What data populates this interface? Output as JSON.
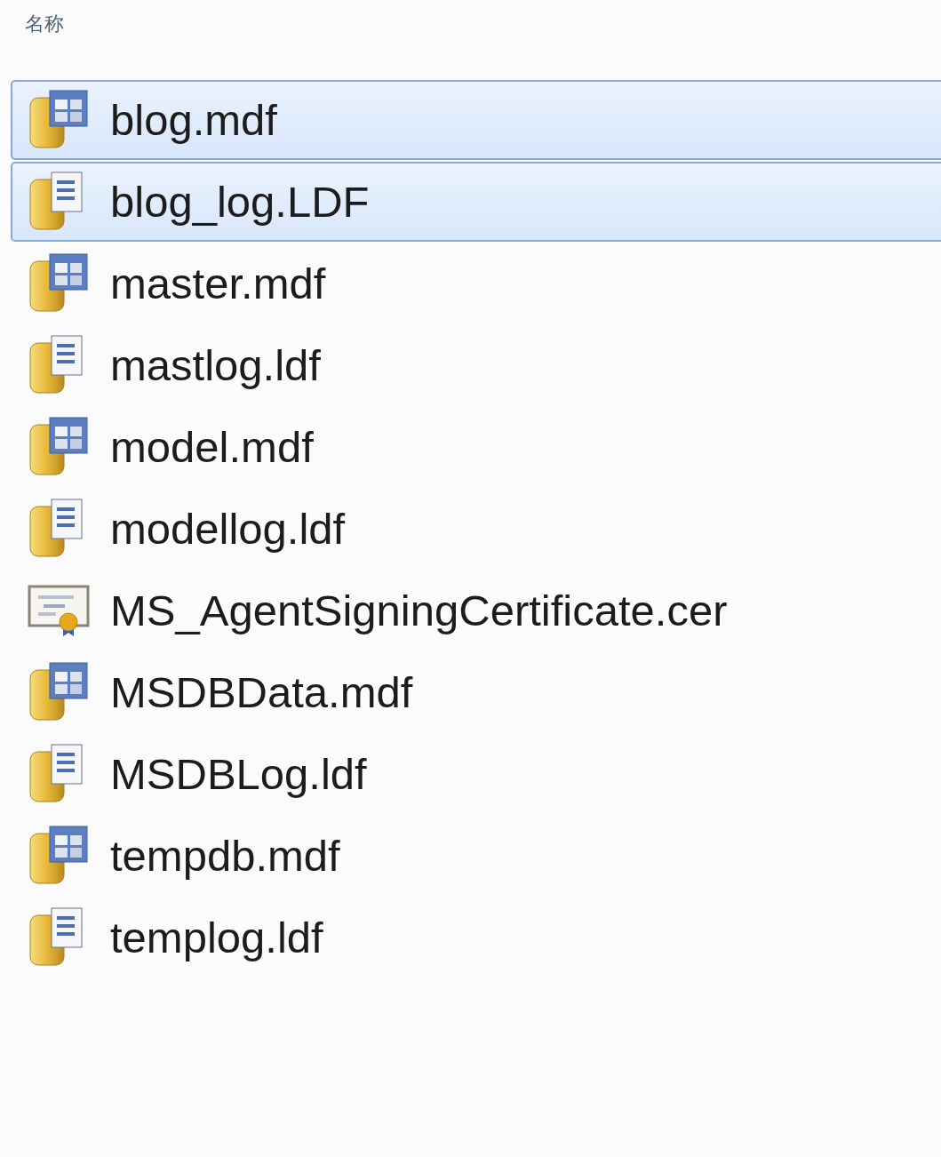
{
  "column_header": "名称",
  "files": [
    {
      "name": "blog.mdf",
      "kind": "database",
      "selected": true
    },
    {
      "name": "blog_log.LDF",
      "kind": "log",
      "selected": true
    },
    {
      "name": "master.mdf",
      "kind": "database",
      "selected": false
    },
    {
      "name": "mastlog.ldf",
      "kind": "log",
      "selected": false
    },
    {
      "name": "model.mdf",
      "kind": "database",
      "selected": false
    },
    {
      "name": "modellog.ldf",
      "kind": "log",
      "selected": false
    },
    {
      "name": "MS_AgentSigningCertificate.cer",
      "kind": "certificate",
      "selected": false
    },
    {
      "name": "MSDBData.mdf",
      "kind": "database",
      "selected": false
    },
    {
      "name": "MSDBLog.ldf",
      "kind": "log",
      "selected": false
    },
    {
      "name": "tempdb.mdf",
      "kind": "database",
      "selected": false
    },
    {
      "name": "templog.ldf",
      "kind": "log",
      "selected": false
    }
  ]
}
